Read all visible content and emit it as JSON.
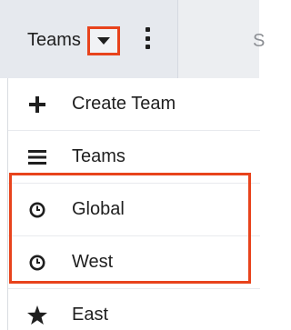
{
  "topbar": {
    "teams_label": "Teams",
    "next_tab_letter": "S"
  },
  "menu": {
    "items": [
      {
        "label": "Create Team",
        "icon": "plus-icon"
      },
      {
        "label": "Teams",
        "icon": "list-icon"
      },
      {
        "label": "Global",
        "icon": "clock-icon"
      },
      {
        "label": "West",
        "icon": "clock-icon"
      },
      {
        "label": "East",
        "icon": "star-icon"
      }
    ]
  },
  "colors": {
    "highlight": "#e8431c",
    "tab_bg": "#e6e9ee"
  }
}
